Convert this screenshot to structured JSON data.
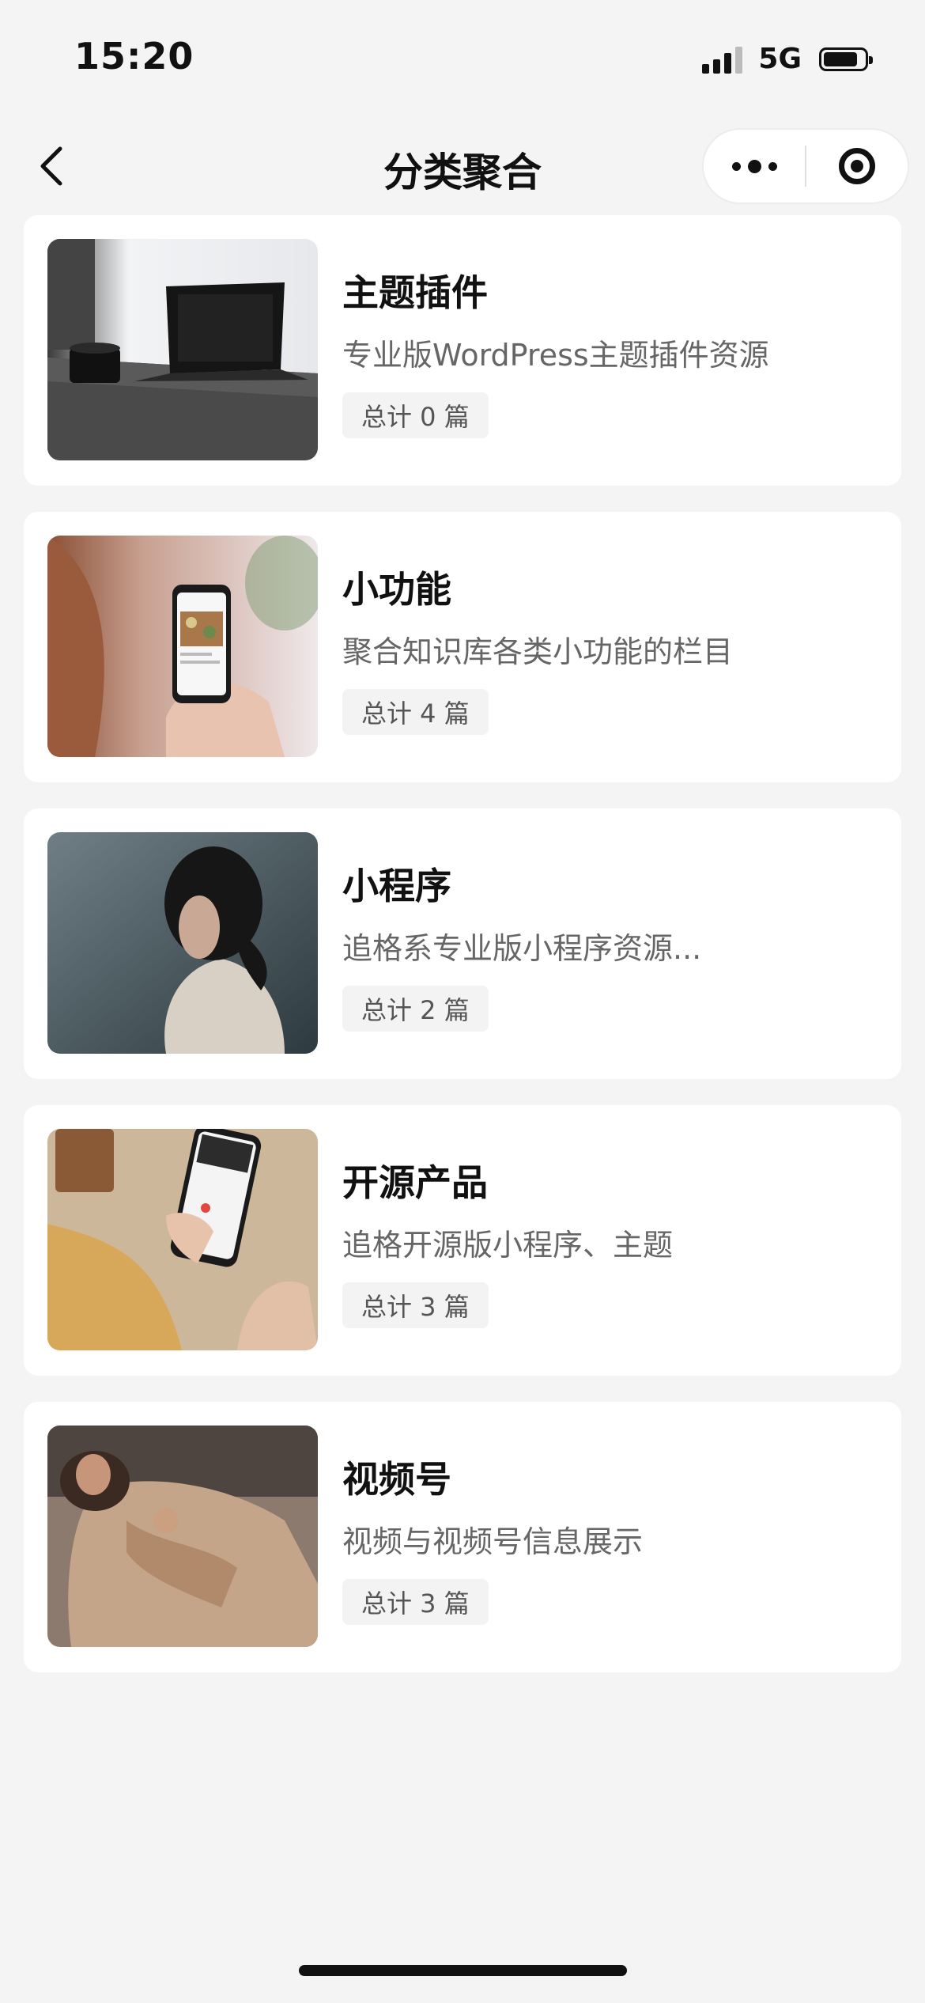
{
  "status_bar": {
    "time": "15:20",
    "network": "5G"
  },
  "nav": {
    "title": "分类聚合"
  },
  "categories": [
    {
      "title": "主题插件",
      "description": "专业版WordPress主题插件资源",
      "count": "总计 0 篇",
      "thumb_icon": "laptop-on-desk-image"
    },
    {
      "title": "小功能",
      "description": "聚合知识库各类小功能的栏目",
      "count": "总计 4 篇",
      "thumb_icon": "hand-holding-phone-image"
    },
    {
      "title": "小程序",
      "description": "追格系专业版小程序资源...",
      "count": "总计 2 篇",
      "thumb_icon": "woman-portrait-image"
    },
    {
      "title": "开源产品",
      "description": "追格开源版小程序、主题",
      "count": "总计 3 篇",
      "thumb_icon": "phone-and-cup-image"
    },
    {
      "title": "视频号",
      "description": "视频与视频号信息展示",
      "count": "总计 3 篇",
      "thumb_icon": "woman-lying-image"
    }
  ]
}
